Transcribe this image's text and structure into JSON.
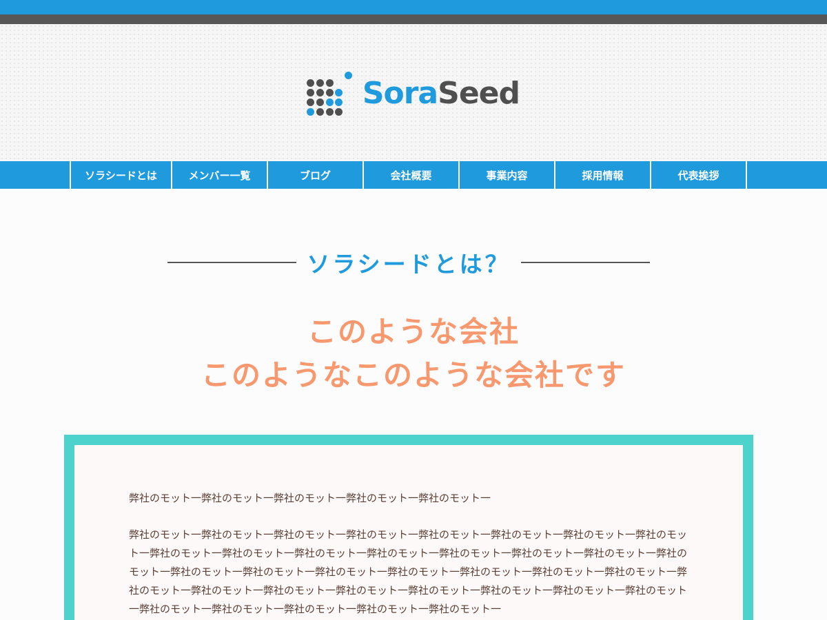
{
  "brand": {
    "name_part1": "Sora",
    "name_part2": "Seed",
    "colors": {
      "blue": "#1e9add",
      "gray": "#575757",
      "accent_orange": "#f7986e",
      "teal": "#4ed2cc"
    }
  },
  "nav": {
    "items": [
      {
        "label": "ソラシードとは"
      },
      {
        "label": "メンバー一覧"
      },
      {
        "label": "ブログ"
      },
      {
        "label": "会社概要"
      },
      {
        "label": "事業内容"
      },
      {
        "label": "採用情報"
      },
      {
        "label": "代表挨拶"
      }
    ]
  },
  "section": {
    "title": "ソラシードとは？"
  },
  "catch": {
    "line1": "このような会社",
    "line2": "このようなこのような会社です"
  },
  "box": {
    "paragraph1": "弊社のモット一弊社のモット一弊社のモット一弊社のモット一弊社のモット一",
    "paragraph2": "弊社のモット一弊社のモット一弊社のモット一弊社のモット一弊社のモット一弊社のモット一弊社のモット一弊社のモット一弊社のモット一弊社のモット一弊社のモット一弊社のモット一弊社のモット一弊社のモット一弊社のモット一弊社のモット一弊社のモット一弊社のモット一弊社のモット一弊社のモット一弊社のモット一弊社のモット一弊社のモット一弊社のモット一弊社のモット一弊社のモット一弊社のモット一弊社のモット一弊社のモット一弊社のモット一弊社のモット一弊社のモット一弊社のモット一弊社のモット一弊社のモット一弊社のモット一"
  }
}
